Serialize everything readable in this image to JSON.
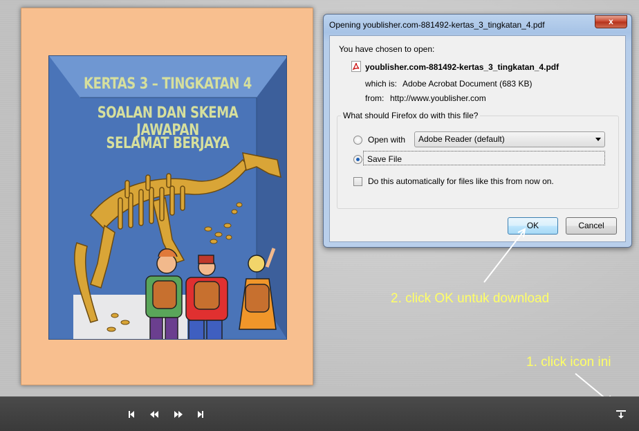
{
  "cover": {
    "title_line1": "KERTAS 3 – TINGKATAN 4",
    "title_line2": "SOALAN DAN SKEMA JAWAPAN",
    "title_line3": "SELAMAT BERJAYA"
  },
  "dialog": {
    "title": "Opening youblisher.com-881492-kertas_3_tingkatan_4.pdf",
    "close_label": "x",
    "intro": "You have chosen to open:",
    "file_name": "youblisher.com-881492-kertas_3_tingkatan_4.pdf",
    "which_is_label": "which is:",
    "which_is_value": "Adobe Acrobat Document (683 KB)",
    "from_label": "from:",
    "from_value": "http://www.youblisher.com",
    "group_label": "What should Firefox do with this file?",
    "open_with_label": "Open with",
    "open_with_selected": "Adobe Reader  (default)",
    "save_file_label": "Save File",
    "auto_label": "Do this automatically for files like this from now on.",
    "ok_label": "OK",
    "cancel_label": "Cancel",
    "save_file_selected": true,
    "auto_checked": false
  },
  "annotations": {
    "step2": "2. click OK untuk download",
    "step1": "1. click icon ini"
  },
  "toolbar": {
    "icons": [
      "first-page-icon",
      "rewind-icon",
      "fast-forward-icon",
      "last-page-icon",
      "download-icon"
    ]
  },
  "colors": {
    "annotation": "#ffff66",
    "cover_bg": "#f8bf8f",
    "art_bg": "#4a74b8",
    "title_text": "#d6df9d"
  }
}
